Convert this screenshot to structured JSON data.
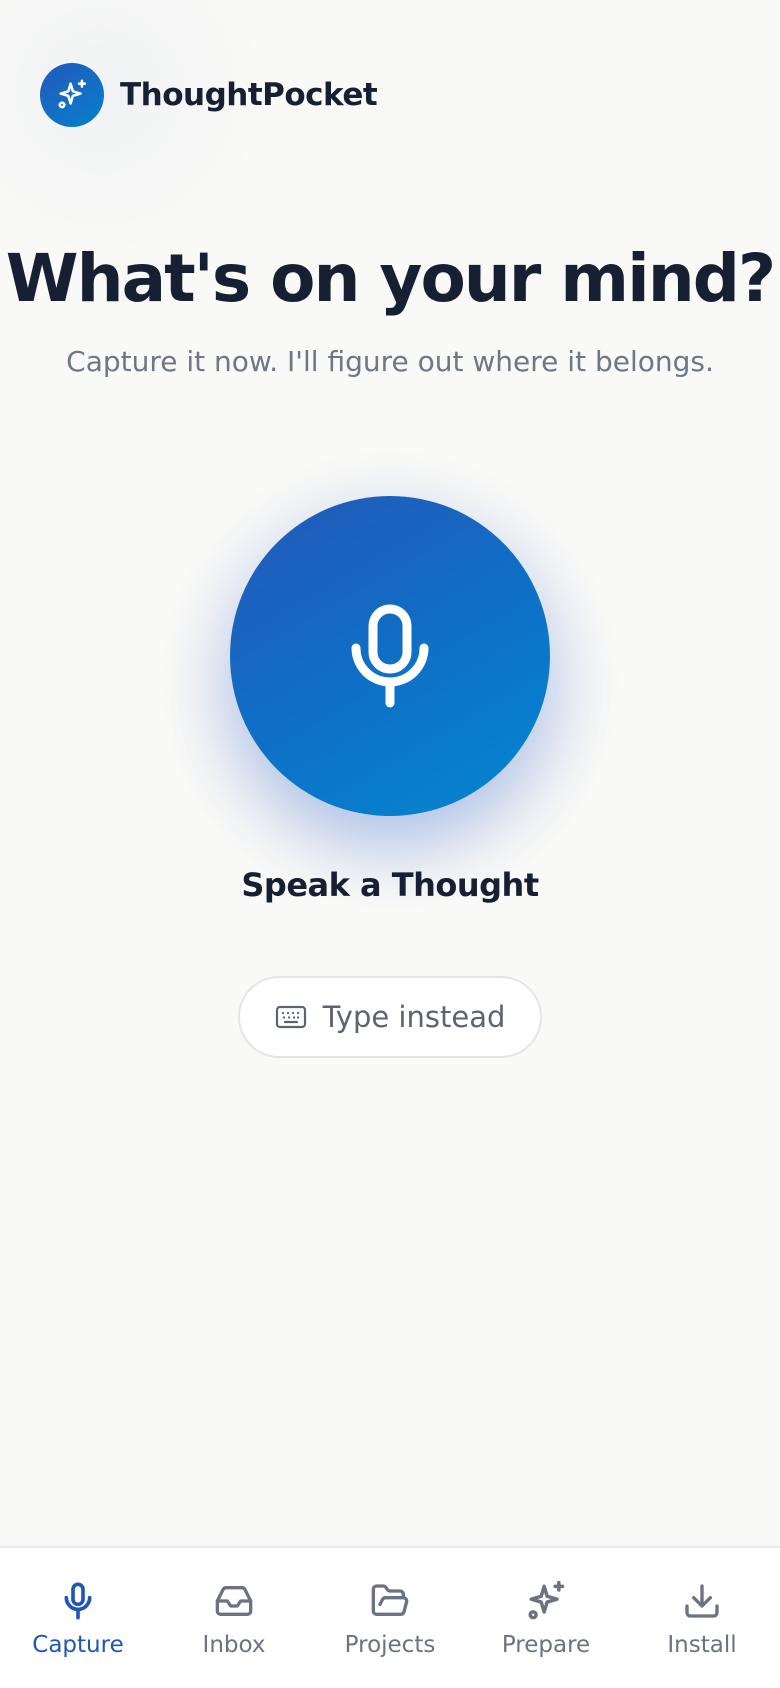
{
  "header": {
    "app_name": "ThoughtPocket",
    "logo_icon": "sparkles-icon"
  },
  "hero": {
    "headline": "What's on your mind?",
    "subtitle": "Capture it now. I'll figure out where it belongs."
  },
  "capture": {
    "mic_icon": "microphone-icon",
    "speak_label": "Speak a Thought",
    "type_label": "Type instead",
    "type_icon": "keyboard-icon"
  },
  "nav": {
    "items": [
      {
        "label": "Capture",
        "icon": "microphone-icon",
        "active": true
      },
      {
        "label": "Inbox",
        "icon": "inbox-icon",
        "active": false
      },
      {
        "label": "Projects",
        "icon": "folder-open-icon",
        "active": false
      },
      {
        "label": "Prepare",
        "icon": "sparkles-icon",
        "active": false
      },
      {
        "label": "Install",
        "icon": "download-icon",
        "active": false
      }
    ]
  },
  "colors": {
    "background": "#f9f9f7",
    "accent": "#1f56b8",
    "accent_light": "#0387d0",
    "text_primary": "#172033",
    "text_muted": "#707784"
  }
}
